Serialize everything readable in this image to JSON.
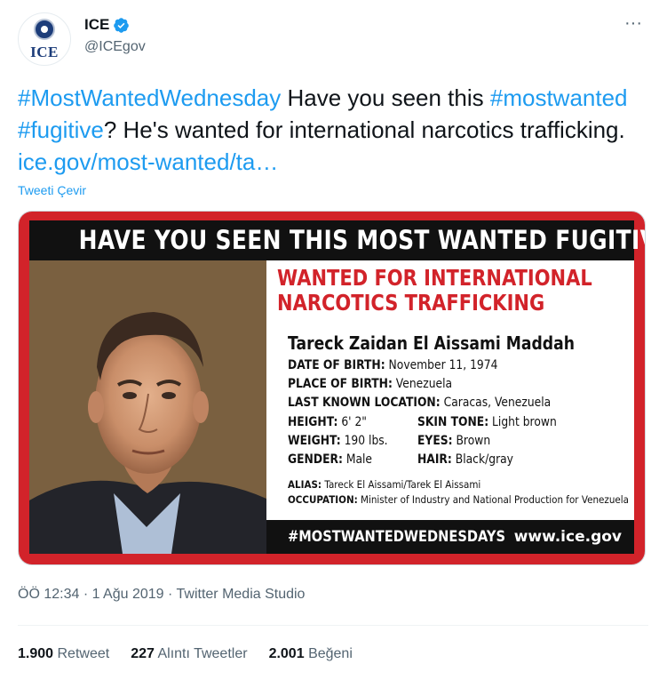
{
  "account": {
    "display_name": "ICE",
    "handle": "@ICEgov",
    "avatar_text": "ICE"
  },
  "tweet": {
    "hashtag1": "#MostWantedWednesday",
    "text1": " Have you seen this ",
    "hashtag2": "#mostwanted",
    "space": " ",
    "hashtag3": "#fugitive",
    "text2": "? He's wanted for international narcotics trafficking. ",
    "link": "ice.gov/most-wanted/ta…",
    "translate_label": "Tweeti Çevir"
  },
  "poster": {
    "banner": "HAVE YOU SEEN THIS MOST WANTED FUGITIVE?",
    "wanted_line1": "WANTED FOR INTERNATIONAL",
    "wanted_line2": "NARCOTICS TRAFFICKING",
    "name": "Tareck Zaidan El Aissami Maddah",
    "dob_label": "DATE OF BIRTH:",
    "dob": "November 11, 1974",
    "pob_label": "PLACE OF BIRTH:",
    "pob": "Venezuela",
    "location_label": "LAST KNOWN LOCATION:",
    "location": "Caracas, Venezuela",
    "height_label": "HEIGHT:",
    "height": "6' 2\"",
    "skin_label": "SKIN TONE:",
    "skin": "Light brown",
    "weight_label": "WEIGHT:",
    "weight": "190 lbs.",
    "eyes_label": "EYES:",
    "eyes": "Brown",
    "gender_label": "GENDER:",
    "gender": "Male",
    "hair_label": "HAIR:",
    "hair": "Black/gray",
    "alias_label": "ALIAS:",
    "alias": "Tareck El Aissami/Tarek El Aissami",
    "occupation_label": "OCCUPATION:",
    "occupation": "Minister of Industry and National Production for Venezuela",
    "footer_hashtag": "#MOSTWANTEDWEDNESDAYS",
    "footer_site": "www.ice.gov"
  },
  "meta": {
    "time": "ÖÖ 12:34",
    "sep1": " · ",
    "date": "1 Ağu 2019",
    "sep2": " · ",
    "source": "Twitter Media Studio"
  },
  "stats": {
    "retweets": "1.900",
    "retweets_label": "Retweet",
    "quotes": "227",
    "quotes_label": "Alıntı Tweetler",
    "likes": "2.001",
    "likes_label": "Beğeni"
  },
  "colors": {
    "link": "#1d9bf0",
    "poster_red": "#d2232a",
    "verified": "#1d9bf0"
  }
}
